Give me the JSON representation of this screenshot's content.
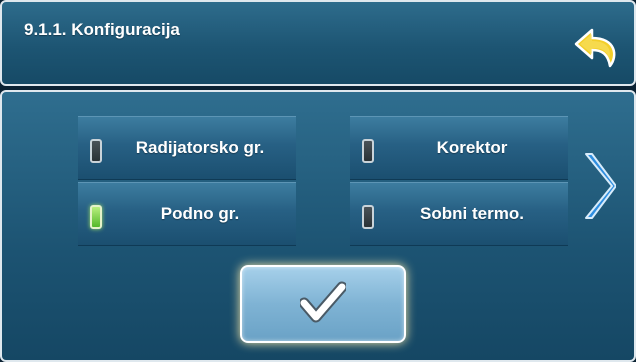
{
  "header": {
    "title": "9.1.1. Konfiguracija"
  },
  "options": [
    {
      "label": "Radijatorsko gr.",
      "active": false
    },
    {
      "label": "Podno gr.",
      "active": true
    },
    {
      "label": "Korektor",
      "active": false
    },
    {
      "label": "Sobni termo.",
      "active": false
    }
  ],
  "icons": {
    "back": "back-arrow-icon",
    "next": "chevron-right-icon",
    "confirm": "checkmark-icon"
  },
  "colors": {
    "led_on": "#6fd13a",
    "led_off": "#3a4449",
    "back_arrow": "#f3cf2a",
    "next_chevron": "#2f8ee0"
  }
}
